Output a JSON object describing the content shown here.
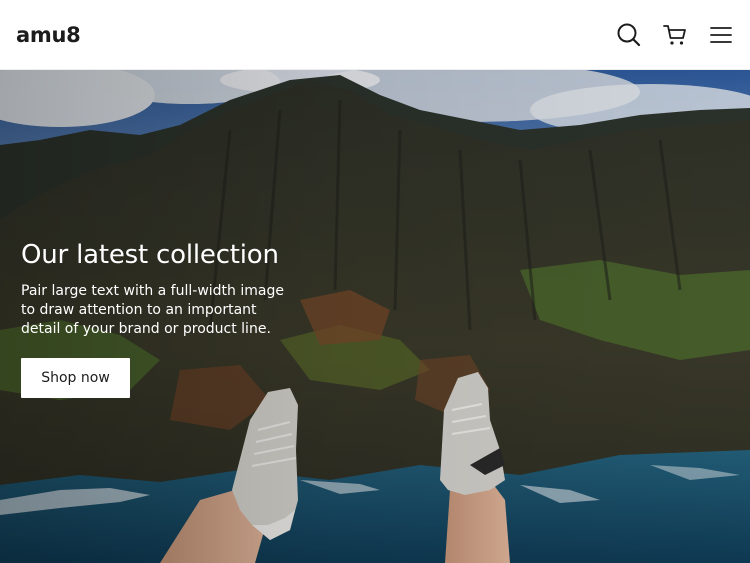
{
  "header": {
    "logo": "amu8",
    "icons": [
      "search-icon",
      "cart-icon",
      "menu-icon"
    ]
  },
  "hero": {
    "title": "Our latest collection",
    "text": "Pair large text with a full-width image to draw attention to an important detail of your brand or product line.",
    "button_label": "Shop now"
  },
  "colors": {
    "text_dark": "#1c1c1c",
    "header_bg": "#ffffff",
    "button_bg": "#ffffff"
  }
}
